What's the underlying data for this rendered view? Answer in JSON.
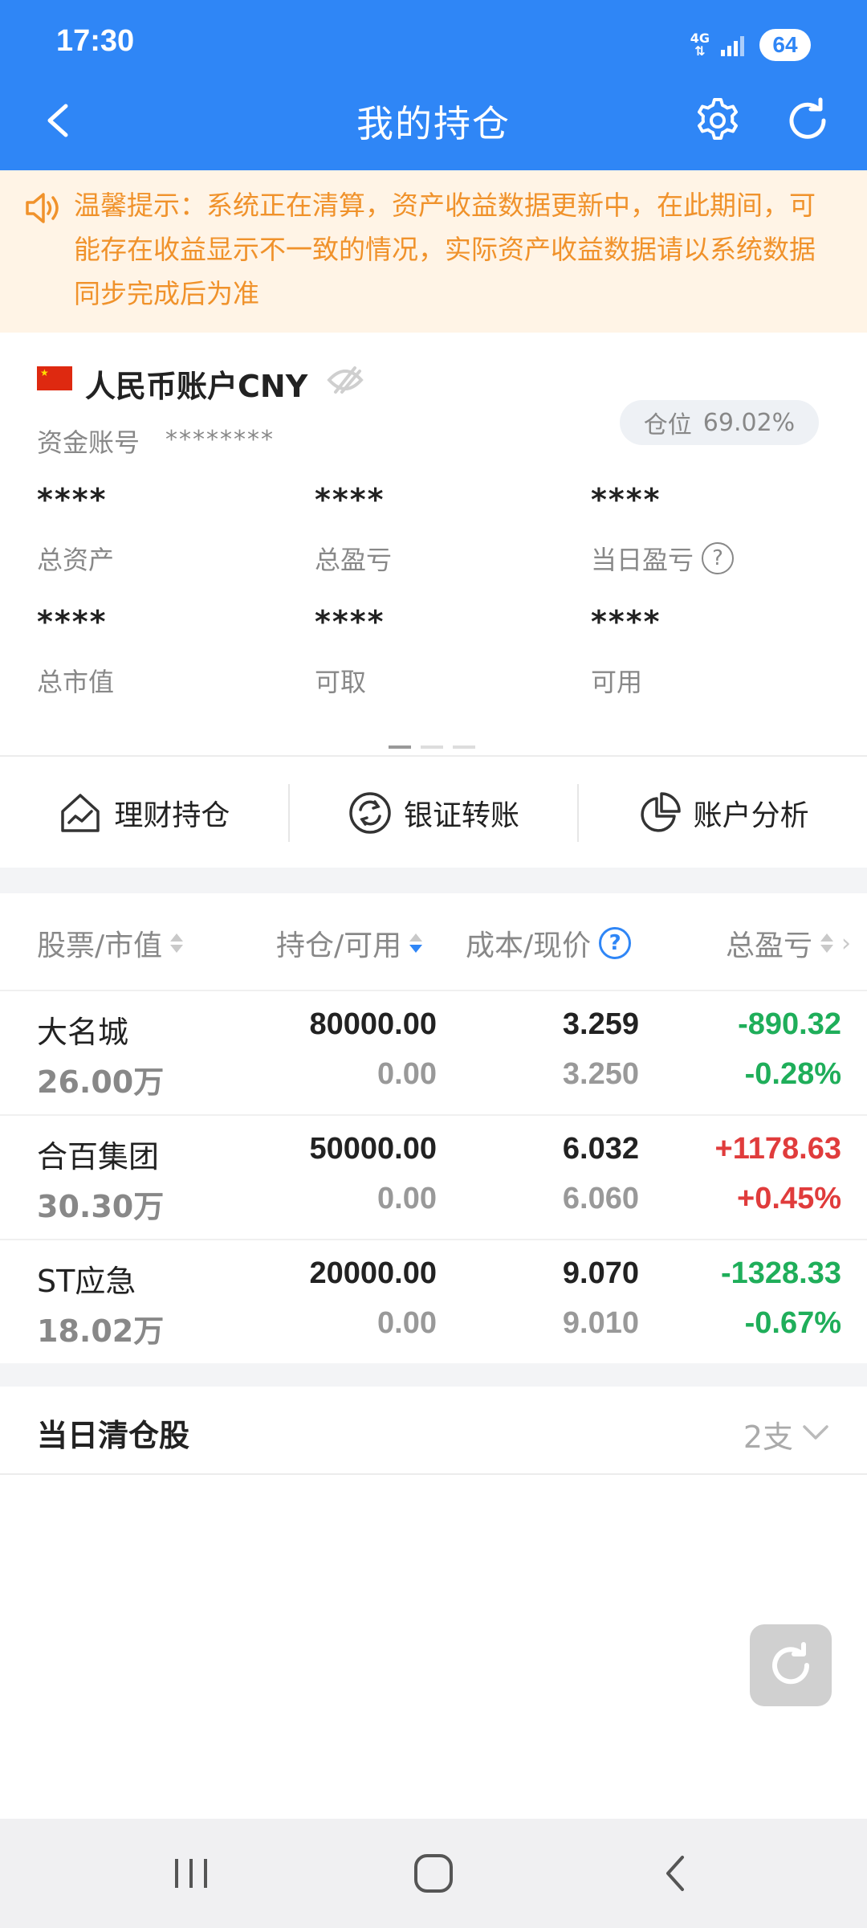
{
  "status_bar": {
    "time": "17:30",
    "network": "4G",
    "battery": "64"
  },
  "header": {
    "title": "我的持仓",
    "icons": [
      "back-icon",
      "gear-icon",
      "refresh-icon"
    ],
    "color": "#2f86f6"
  },
  "notice": {
    "icon": "speaker-icon",
    "text": "温馨提示：系统正在清算，资产收益数据更新中，在此期间，可能存在收益显示不一致的情况，实际资产收益数据请以系统数据同步完成后为准"
  },
  "account": {
    "name": "人民币账户CNY",
    "account_label": "资金账号",
    "account_value": "********",
    "position_label": "仓位",
    "position_value": "69.02%",
    "stats": [
      {
        "label": "总资产",
        "value": "****"
      },
      {
        "label": "总盈亏",
        "value": "****"
      },
      {
        "label": "当日盈亏",
        "value": "****"
      },
      {
        "label": "总市值",
        "value": "****"
      },
      {
        "label": "可取",
        "value": "****"
      },
      {
        "label": "可用",
        "value": "****"
      }
    ],
    "help_mark": "?"
  },
  "actions": [
    {
      "label": "理财持仓",
      "icon": "house-chart-icon"
    },
    {
      "label": "银证转账",
      "icon": "transfer-icon"
    },
    {
      "label": "账户分析",
      "icon": "pie-chart-icon"
    }
  ],
  "table": {
    "headers": {
      "stock": "股票/市值",
      "holding": "持仓/可用",
      "cost": "成本/现价",
      "pnl": "总盈亏"
    },
    "help_mark": "?",
    "rows": [
      {
        "name": "大名城",
        "market_value": "26.00万",
        "holding": "80000.00",
        "available": "0.00",
        "cost": "3.259",
        "price": "3.250",
        "pnl": "-890.32",
        "pnl_pct": "-0.28%",
        "trend": "down"
      },
      {
        "name": "合百集团",
        "market_value": "30.30万",
        "holding": "50000.00",
        "available": "0.00",
        "cost": "6.032",
        "price": "6.060",
        "pnl": "+1178.63",
        "pnl_pct": "+0.45%",
        "trend": "up"
      },
      {
        "name": "ST应急",
        "market_value": "18.02万",
        "holding": "20000.00",
        "available": "0.00",
        "cost": "9.070",
        "price": "9.010",
        "pnl": "-1328.33",
        "pnl_pct": "-0.67%",
        "trend": "down"
      }
    ],
    "colors": {
      "up": "#e03c3c",
      "down": "#1fae5a"
    }
  },
  "closed_today": {
    "title": "当日清仓股",
    "count": "2支"
  }
}
